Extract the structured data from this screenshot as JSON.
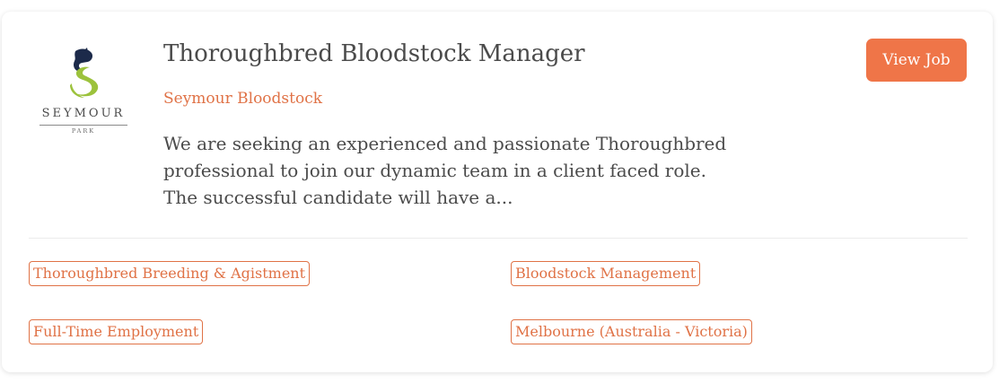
{
  "job": {
    "title": "Thoroughbred Bloodstock Manager",
    "company": "Seymour Bloodstock",
    "description": "We are seeking an experienced and passionate Thoroughbred professional to join our dynamic team in a client faced role. The successful candidate will have a...",
    "view_label": "View Job"
  },
  "logo": {
    "name": "SEYMOUR",
    "subtitle": "PARK",
    "colors": {
      "navy": "#1c2a4a",
      "green": "#9cc23c"
    }
  },
  "tags": [
    "Thoroughbred Breeding & Agistment",
    "Bloodstock Management",
    "Full-Time Employment",
    "Melbourne (Australia - Victoria)"
  ],
  "colors": {
    "accent": "#ef7548",
    "link": "#e07246",
    "text": "#4b4b4b"
  }
}
